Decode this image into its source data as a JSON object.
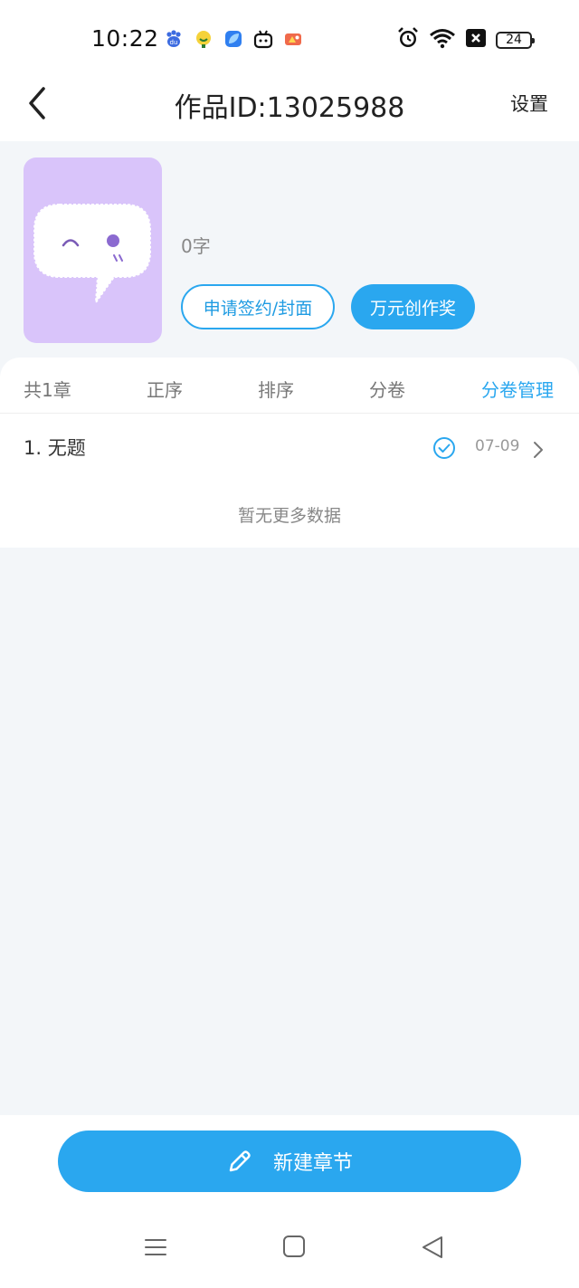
{
  "status": {
    "time": "10:22",
    "battery": "24",
    "app_icons": [
      "baidu-icon",
      "smile-app-icon",
      "leaf-app-icon",
      "bilibili-icon",
      "game-app-icon"
    ],
    "system_icons": [
      "alarm-icon",
      "wifi-icon",
      "sim-blocked-icon",
      "battery-icon"
    ]
  },
  "header": {
    "title": "作品ID:13025988",
    "settings_label": "设置"
  },
  "book": {
    "word_count": "0字",
    "apply_button": "申请签约/封面",
    "award_button": "万元创作奖"
  },
  "toolbar": {
    "count_label": "共1章",
    "asc_label": "正序",
    "sort_label": "排序",
    "split_label": "分卷",
    "manage_label": "分卷管理"
  },
  "chapters": [
    {
      "title": "1. 无题",
      "date": "07-09"
    }
  ],
  "list_footer": "暂无更多数据",
  "bottom": {
    "new_chapter_label": "新建章节"
  },
  "colors": {
    "accent": "#2aa7ef",
    "cover_bg": "#d9c4fa",
    "page_bg": "#f3f6f9"
  }
}
